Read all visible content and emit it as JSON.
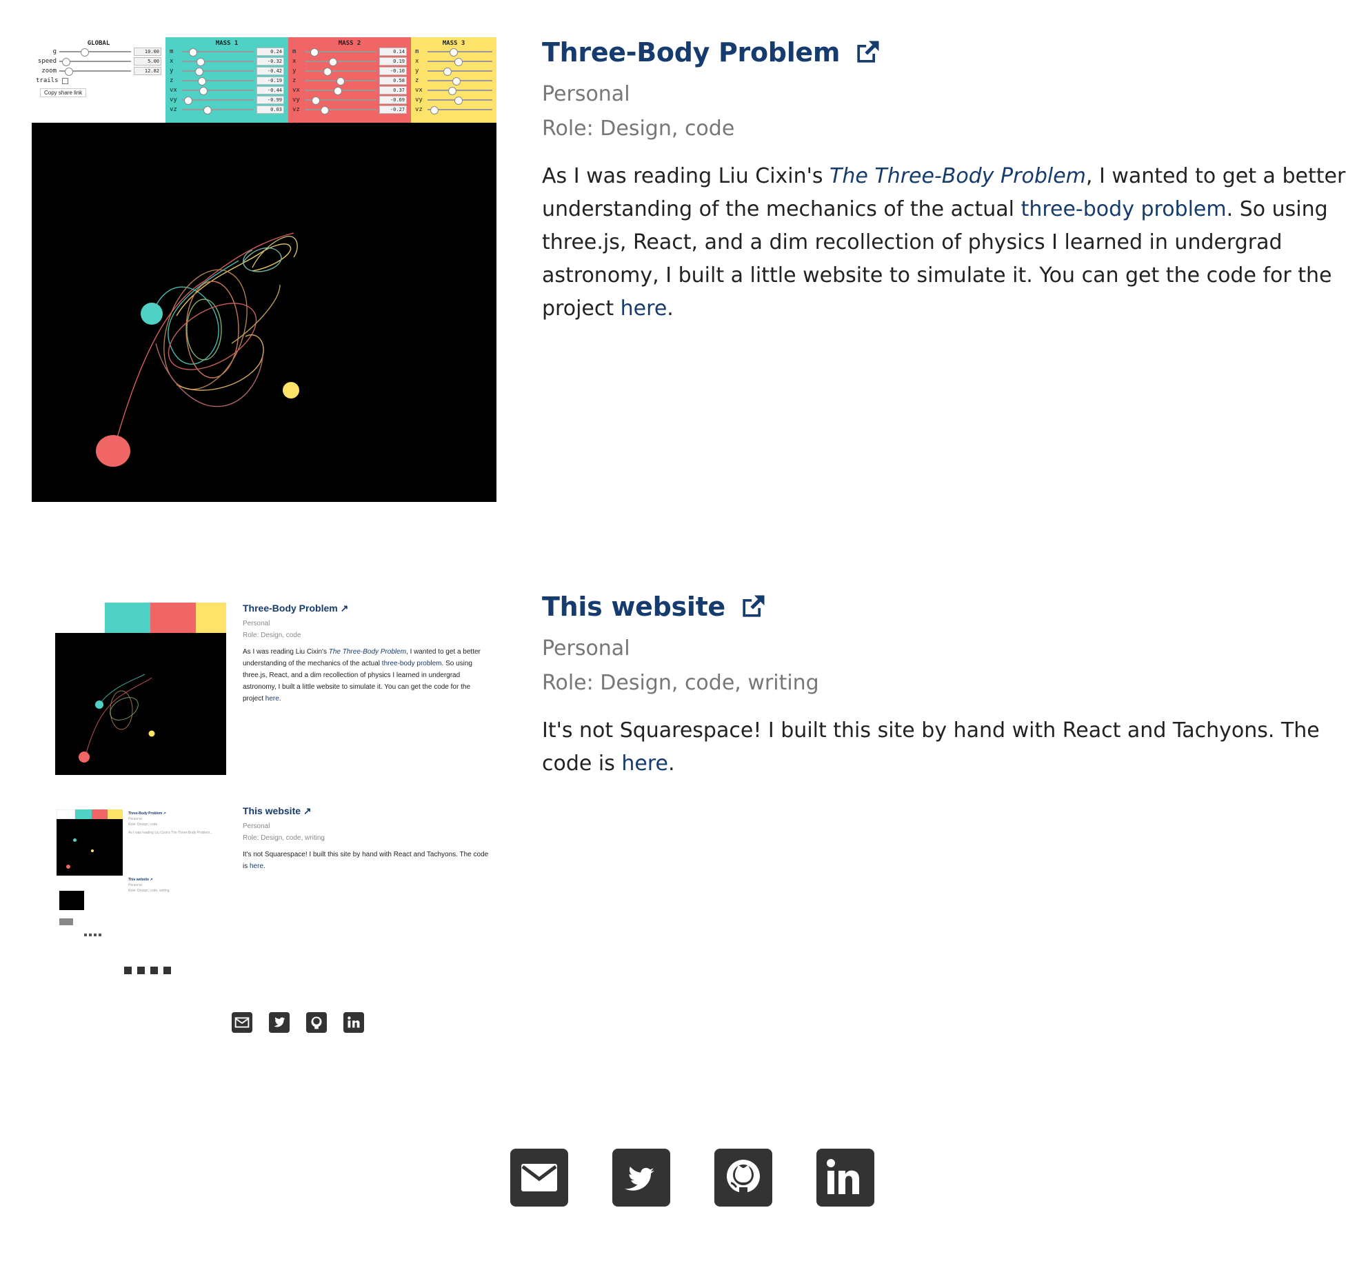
{
  "projects": [
    {
      "title": "Three-Body Problem",
      "category": "Personal",
      "role": "Role: Design, code",
      "desc": {
        "p1": "As I was reading Liu Cixin's ",
        "book": "The Three-Body Problem",
        "p2": ", I wanted to get a better understanding of the mechanics of the actual ",
        "link1": "three-body problem",
        "p3": ". So using three.js, React, and a dim recollection of physics I learned in undergrad astronomy, I built a little website to simulate it. You can get the code for the project ",
        "link2": "here",
        "p4": "."
      }
    },
    {
      "title": "This website",
      "category": "Personal",
      "role": "Role: Design, code, writing",
      "desc": {
        "p1": "It's not Squarespace! I built this site by hand with React and Tachyons. The code is ",
        "link": "here",
        "p2": "."
      }
    }
  ],
  "sim_panel": {
    "global": {
      "header": "GLOBAL",
      "rows": [
        {
          "label": "g",
          "value": "10.00"
        },
        {
          "label": "speed",
          "value": "5.00"
        },
        {
          "label": "zoom",
          "value": "12.82"
        },
        {
          "label": "trails",
          "value": ""
        }
      ],
      "copy_link": "Copy share link"
    },
    "masses": [
      {
        "header": "MASS 1",
        "color": "#4fd1c5",
        "rows": [
          {
            "label": "m",
            "value": "0.24"
          },
          {
            "label": "x",
            "value": "-0.32"
          },
          {
            "label": "y",
            "value": "-0.42"
          },
          {
            "label": "z",
            "value": "-0.19"
          },
          {
            "label": "vx",
            "value": "-0.44"
          },
          {
            "label": "vy",
            "value": "-0.99"
          },
          {
            "label": "vz",
            "value": "0.03"
          }
        ]
      },
      {
        "header": "MASS 2",
        "color": "#f06666",
        "rows": [
          {
            "label": "m",
            "value": "0.14"
          },
          {
            "label": "x",
            "value": "0.19"
          },
          {
            "label": "y",
            "value": "-0.10"
          },
          {
            "label": "z",
            "value": "0.58"
          },
          {
            "label": "vx",
            "value": "0.37"
          },
          {
            "label": "vy",
            "value": "-0.69"
          },
          {
            "label": "vz",
            "value": "-0.27"
          }
        ]
      },
      {
        "header": "MASS 3",
        "color": "#fde36a",
        "rows": [
          {
            "label": "m",
            "value": ""
          },
          {
            "label": "x",
            "value": ""
          },
          {
            "label": "y",
            "value": ""
          },
          {
            "label": "z",
            "value": ""
          },
          {
            "label": "vx",
            "value": ""
          },
          {
            "label": "vy",
            "value": ""
          },
          {
            "label": "vz",
            "value": ""
          }
        ]
      }
    ]
  },
  "socials": [
    {
      "name": "email",
      "icon": "email-icon"
    },
    {
      "name": "twitter",
      "icon": "twitter-icon"
    },
    {
      "name": "github",
      "icon": "github-icon"
    },
    {
      "name": "linkedin",
      "icon": "linkedin-icon"
    }
  ],
  "colors": {
    "accent": "#163b6e",
    "mass1": "#4fd1c5",
    "mass2": "#f06666",
    "mass3": "#fde36a",
    "icon_bg": "#333333"
  }
}
